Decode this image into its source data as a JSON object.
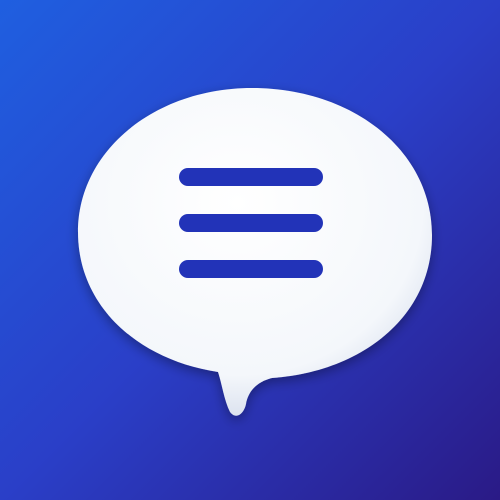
{
  "icon": {
    "semantic": "chat-bubble-menu-icon",
    "colors": {
      "background_top_left": "#1f5fe0",
      "background_mid": "#2a3fc8",
      "background_bottom_right": "#2a1a86",
      "bubble_fill": "#f4f7fb",
      "bubble_shadow": "#c9d2e6",
      "menu_lines": "#2233b8"
    },
    "menu_line_count": 3
  }
}
